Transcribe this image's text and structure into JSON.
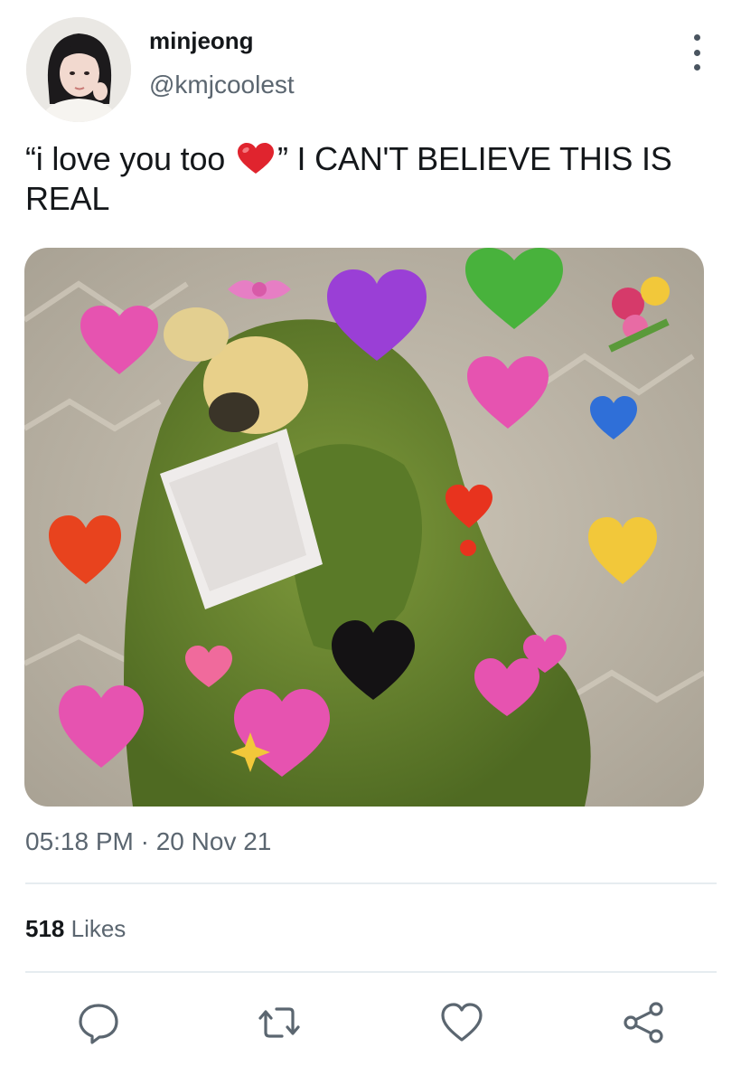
{
  "tweet": {
    "display_name": "minjeong",
    "handle": "@kmjcoolest",
    "text_before": "“i love you too ",
    "text_after": "” I CAN'T BELIEVE THIS IS REAL",
    "timestamp": "05:18 PM · 20 Nov 21",
    "likes_count": "518",
    "likes_label": " Likes"
  },
  "icons": {
    "more": "more-vertical-icon",
    "reply": "reply-icon",
    "retweet": "retweet-icon",
    "like": "heart-icon",
    "share": "share-icon"
  },
  "colors": {
    "text": "#14171a",
    "muted": "#5b6670",
    "divider": "#e6ecf0",
    "emoji_heart": "#e0242e"
  }
}
